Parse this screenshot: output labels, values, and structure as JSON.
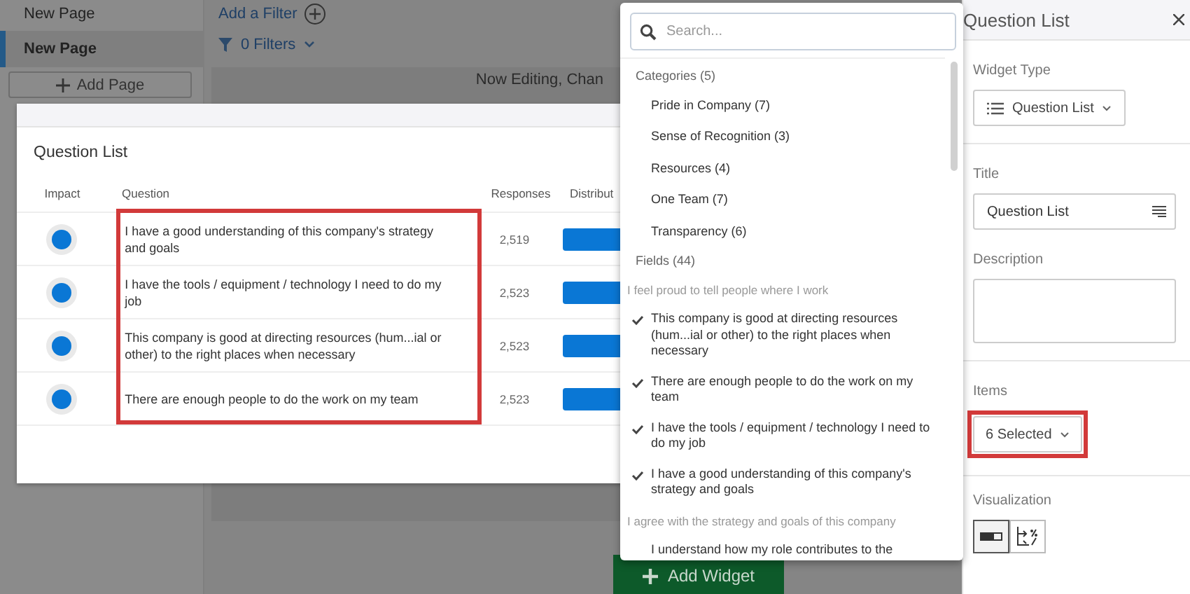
{
  "sidebar": {
    "pages": [
      {
        "label": "New Page",
        "selected": false
      },
      {
        "label": "New Page",
        "selected": true
      }
    ],
    "add_page": "Add Page"
  },
  "toolbar": {
    "add_filter": "Add a Filter",
    "filters": "0 Filters"
  },
  "editing_banner": "Now Editing, Chan",
  "modal": {
    "title": "Question List",
    "columns": [
      "Impact",
      "Question",
      "Responses",
      "Distribut"
    ],
    "question_column_highlighted": true,
    "rows": [
      {
        "question": "I have a good understanding of this company's strategy and goals",
        "responses": "2,519"
      },
      {
        "question": "I have the tools / equipment / technology I need to do my job",
        "responses": "2,523"
      },
      {
        "question": "This company is good at directing resources (hum...ial or other) to the right places when necessary",
        "responses": "2,523"
      },
      {
        "question": "There are enough people to do the work on my team",
        "responses": "2,523"
      }
    ]
  },
  "dropdown": {
    "placeholder": "Search...",
    "entries": [
      {
        "kind": "section",
        "label": "Categories (5)"
      },
      {
        "kind": "category",
        "label": "Pride in Company (7)"
      },
      {
        "kind": "category",
        "label": "Sense of Recognition (3)"
      },
      {
        "kind": "category",
        "label": "Resources (4)"
      },
      {
        "kind": "category",
        "label": "One Team (7)"
      },
      {
        "kind": "category",
        "label": "Transparency (6)"
      },
      {
        "kind": "section",
        "label": "Fields (44)"
      },
      {
        "kind": "group",
        "label": "I feel proud to tell people where I work"
      },
      {
        "kind": "field",
        "label": "This company is good at directing resources (hum...ial or other) to the right places when necessary",
        "checked": true
      },
      {
        "kind": "field",
        "label": "There are enough people to do the work on my team",
        "checked": true
      },
      {
        "kind": "field",
        "label": "I have the tools / equipment / technology I need to do my job",
        "checked": true
      },
      {
        "kind": "field",
        "label": "I have a good understanding of this company's strategy and goals",
        "checked": true
      },
      {
        "kind": "group",
        "label": "I agree with the strategy and goals of this company"
      },
      {
        "kind": "field",
        "label": "I understand how my role contributes to the",
        "checked": false
      }
    ]
  },
  "add_widget": "Add Widget",
  "panel": {
    "title": "Question List",
    "widget_type_label": "Widget Type",
    "widget_type": "Question List",
    "title_label": "Title",
    "title_value": "Question List",
    "description_label": "Description",
    "items_label": "Items",
    "items_value": "6 Selected",
    "items_highlighted": true,
    "visualization_label": "Visualization",
    "visualizations": [
      {
        "kind": "bar",
        "selected": true
      },
      {
        "kind": "percent",
        "selected": false
      }
    ]
  }
}
